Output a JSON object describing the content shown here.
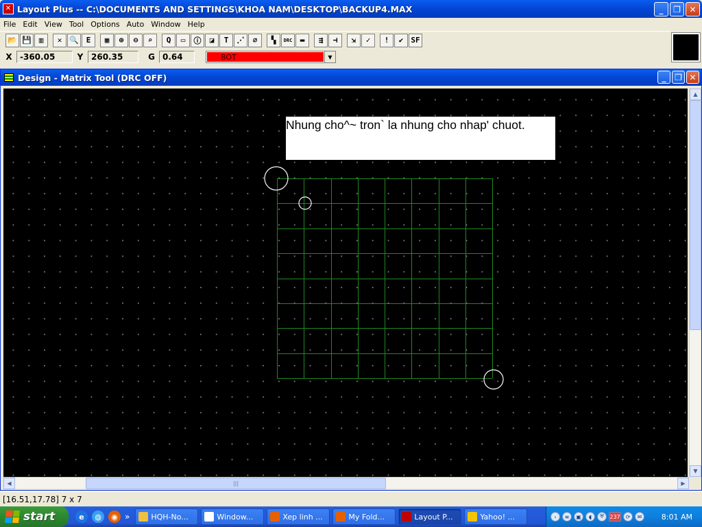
{
  "app": {
    "title": "Layout Plus -- C:\\DOCUMENTS AND SETTINGS\\KHOA NAM\\DESKTOP\\BACKUP4.MAX",
    "icon": "app-icon"
  },
  "window_controls": {
    "minimize": "_",
    "maximize": "❐",
    "close": "✕"
  },
  "menu": [
    "File",
    "Edit",
    "View",
    "Tool",
    "Options",
    "Auto",
    "Window",
    "Help"
  ],
  "toolbar": {
    "buttons": [
      {
        "name": "open-icon",
        "glyph": "📂"
      },
      {
        "name": "save-icon",
        "glyph": "💾"
      },
      {
        "name": "print-icon",
        "glyph": "▥"
      },
      {
        "name": "delete-icon",
        "glyph": "✕"
      },
      {
        "name": "find-icon",
        "glyph": "🔍"
      },
      {
        "name": "edit-icon",
        "glyph": "E"
      },
      {
        "name": "grid-icon",
        "glyph": "▦"
      },
      {
        "name": "zoom-in-icon",
        "glyph": "⊕"
      },
      {
        "name": "zoom-out-icon",
        "glyph": "⊖"
      },
      {
        "name": "zoom-fit-icon",
        "glyph": "⌕"
      },
      {
        "name": "query-icon",
        "glyph": "Q"
      },
      {
        "name": "component-icon",
        "glyph": "▭"
      },
      {
        "name": "info-icon",
        "glyph": "ⓘ"
      },
      {
        "name": "pad-icon",
        "glyph": "◪"
      },
      {
        "name": "text-icon",
        "glyph": "T"
      },
      {
        "name": "route-icon",
        "glyph": "⋰"
      },
      {
        "name": "obstacle-icon",
        "glyph": "⌀"
      },
      {
        "name": "color-icon",
        "glyph": "▚"
      },
      {
        "name": "drc-icon",
        "glyph": "DRC"
      },
      {
        "name": "layer-icon",
        "glyph": "▬"
      },
      {
        "name": "autoroute-icon",
        "glyph": "⇶"
      },
      {
        "name": "split-icon",
        "glyph": "⊣"
      },
      {
        "name": "push-icon",
        "glyph": "⇲"
      },
      {
        "name": "check-icon",
        "glyph": "✓"
      },
      {
        "name": "error-icon",
        "glyph": "!"
      },
      {
        "name": "drc-check-icon",
        "glyph": "✔"
      },
      {
        "name": "spreadsheet-icon",
        "glyph": "SF"
      }
    ]
  },
  "coords": {
    "x_label": "X",
    "x_value": "-360.05",
    "y_label": "Y",
    "y_value": "260.35",
    "g_label": "G",
    "g_value": "0.64",
    "layer": "BOT",
    "layer_color": "#ff0000"
  },
  "child_window": {
    "title": "Design - Matrix Tool (DRC OFF)",
    "icon": "design-icon"
  },
  "canvas": {
    "annotation": "Nhung cho^~ tron` la nhung cho nhap' chuot.",
    "matrix": {
      "rows": 8,
      "cols": 8,
      "line_color": "#1f8a1f"
    },
    "markers": [
      "start-click-circle",
      "cell-click-circle",
      "end-click-circle"
    ]
  },
  "statusbar": {
    "text": "[16.51,17.78] 7 x 7"
  },
  "taskbar": {
    "start_label": "start",
    "quick_launch": [
      {
        "name": "ie-icon",
        "glyph": "e",
        "color": "#1e73e0"
      },
      {
        "name": "desktop-icon",
        "glyph": "◍",
        "color": "#3aa0f0"
      },
      {
        "name": "firefox-icon",
        "glyph": "◉",
        "color": "#e66000"
      }
    ],
    "overflow": "»",
    "tasks": [
      {
        "label": "HQH-No...",
        "icon_color": "#f0c040",
        "active": false
      },
      {
        "label": "Window...",
        "icon_color": "#ffffff",
        "active": false
      },
      {
        "label": "Xep linh ...",
        "icon_color": "#e66000",
        "active": false
      },
      {
        "label": "My Fold...",
        "icon_color": "#e66000",
        "active": false
      },
      {
        "label": "Layout P...",
        "icon_color": "#c00000",
        "active": true
      },
      {
        "label": "Yahoo! ...",
        "icon_color": "#f5c400",
        "active": false
      }
    ],
    "tray": {
      "badge": "237",
      "clock": "8:01 AM"
    }
  }
}
